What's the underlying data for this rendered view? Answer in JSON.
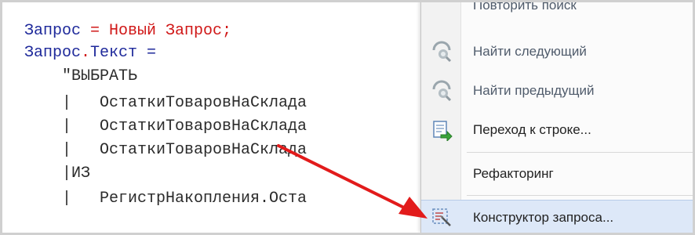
{
  "editor": {
    "lines": [
      {
        "p1": "Запрос",
        "p2": " = ",
        "p3": "Новый Запрос",
        "p4": ";"
      },
      {
        "p1": "Запрос",
        "p2": ".",
        "p3": "Текст",
        "p4": " ="
      },
      {
        "text": "    \"ВЫБРАТЬ"
      },
      {
        "text": "    |   ОстаткиТоваровНаСклада"
      },
      {
        "text": "    |   ОстаткиТоваровНаСклада"
      },
      {
        "text": "    |   ОстаткиТоваровНаСклада"
      },
      {
        "text": "    |ИЗ"
      },
      {
        "text": "    |   РегистрНакопления.Оста"
      }
    ]
  },
  "context_menu": {
    "items": [
      {
        "label": "Повторить поиск",
        "icon": "none",
        "disabled": true
      },
      {
        "label": "Найти следующий",
        "icon": "find-next-icon",
        "disabled": true
      },
      {
        "label": "Найти предыдущий",
        "icon": "find-previous-icon",
        "disabled": true
      },
      {
        "label": "Переход к строке...",
        "icon": "goto-line-icon",
        "disabled": false
      },
      {
        "label": "Рефакторинг",
        "icon": "none",
        "disabled": false
      },
      {
        "label": "Конструктор запроса...",
        "icon": "query-builder-icon",
        "disabled": false,
        "highlighted": true
      }
    ]
  },
  "colors": {
    "keyword": "#1f2a9b",
    "operator": "#d01818",
    "arrow": "#e21b1b",
    "menu_highlight": "#dde8f8"
  }
}
